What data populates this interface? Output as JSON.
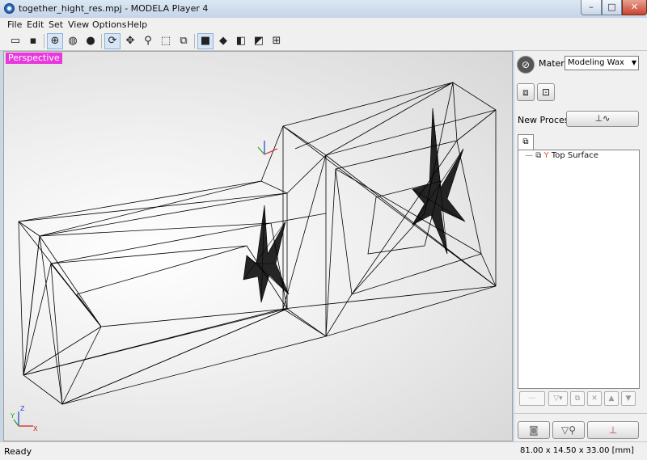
{
  "window": {
    "title": "together_hight_res.mpj - MODELA Player 4",
    "minimize_glyph": "–",
    "maximize_glyph": "□",
    "close_glyph": "✕"
  },
  "menu": [
    "File",
    "Edit",
    "Set",
    "View",
    "Options",
    "Help"
  ],
  "toolbar": {
    "icons": [
      "open-folder-icon",
      "save-icon",
      "wireframe-view-icon",
      "shaded-sphere-icon",
      "solid-sphere-icon",
      "rotate-icon",
      "pan-icon",
      "zoom-icon",
      "zoom-fit-icon",
      "zoom-box-icon",
      "view-front-icon",
      "view-top-icon",
      "view-side-icon",
      "view-iso-icon",
      "view-multi-icon"
    ],
    "glyphs": [
      "▭",
      "▪",
      "⊕",
      "◍",
      "●",
      "⟳",
      "✥",
      "⚲",
      "⬚",
      "⧉",
      "■",
      "◆",
      "◧",
      "◩",
      "⊞"
    ]
  },
  "viewport": {
    "view_label": "Perspective",
    "label_color": "#e838dd",
    "axis_labels": {
      "x": "X",
      "y": "Y",
      "z": "Z"
    }
  },
  "side_panel": {
    "compass_glyph": "⊘",
    "material_label": "Material",
    "material_value": "Modeling Wax",
    "dropdown_glyph": "▼",
    "stock_glyph": "⧈",
    "fixture_glyph": "⊡",
    "new_process_label": "New Process",
    "new_process_glyph": "⊥∿",
    "tree_tab_glyph": "⧉",
    "tree": {
      "connector": "—",
      "model_glyph": "⧉",
      "process_glyph": "Y",
      "item_label": "Top Surface"
    },
    "small_buttons": [
      "⋯",
      "▽▾",
      "⧉",
      "✕",
      "▲",
      "▼"
    ],
    "bottom_buttons": [
      "◙",
      "▽⚲",
      "⊥"
    ]
  },
  "status": {
    "ready": "Ready",
    "dimensions": "81.00 x 14.50 x 33.00 [mm]"
  }
}
